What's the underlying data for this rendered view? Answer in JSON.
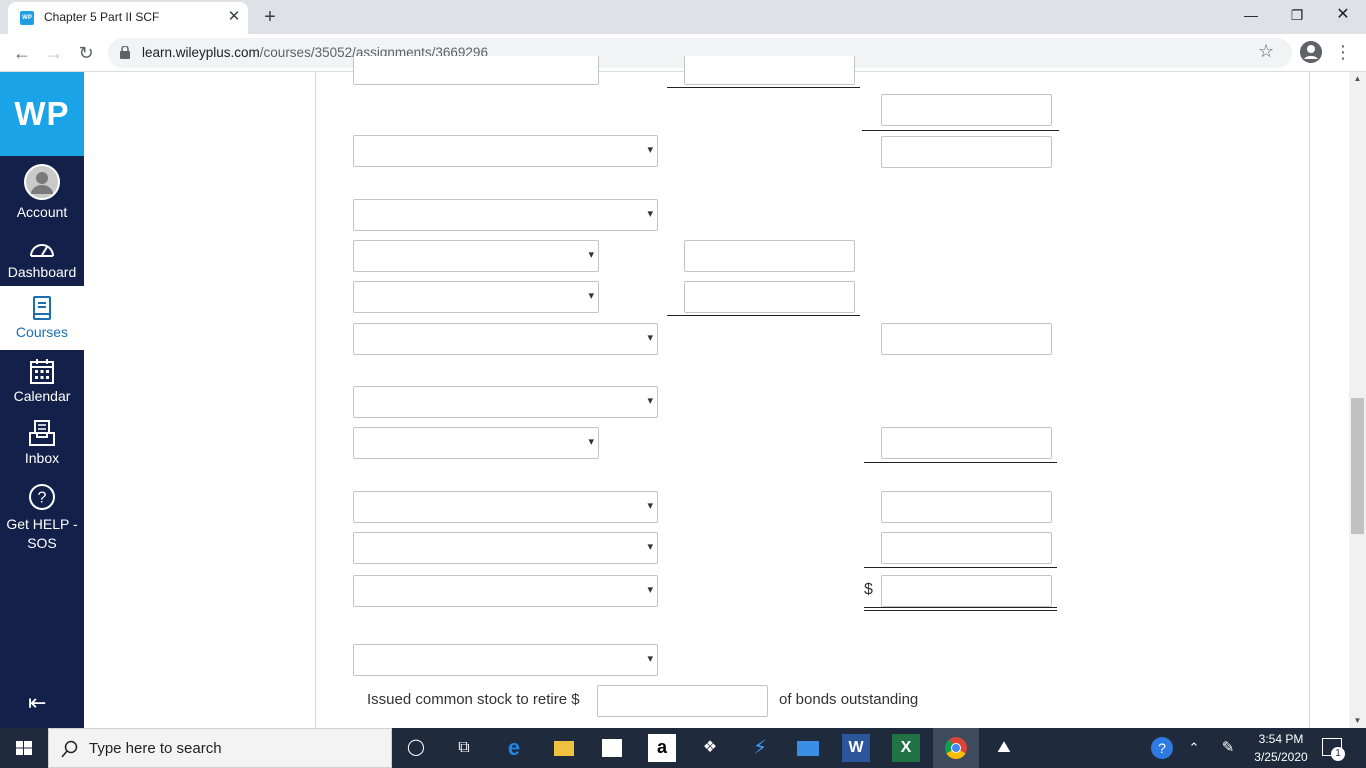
{
  "browser": {
    "tab_title": "Chapter 5 Part II SCF",
    "tab_favicon": "WP",
    "url_host": "learn.wileyplus.com",
    "url_path": "/courses/35052/assignments/3669296"
  },
  "sidebar": {
    "logo": "WP",
    "items": [
      {
        "label": "Account",
        "icon": "user-avatar-icon"
      },
      {
        "label": "Dashboard",
        "icon": "speedometer-icon"
      },
      {
        "label": "Courses",
        "icon": "book-icon"
      },
      {
        "label": "Calendar",
        "icon": "calendar-icon"
      },
      {
        "label": "Inbox",
        "icon": "inbox-icon"
      },
      {
        "label": "Get HELP - SOS",
        "icon": "help-icon"
      }
    ],
    "active_item": "Courses",
    "accent_color": "#1aa3e6",
    "bg_color": "#13204a"
  },
  "form": {
    "currency_symbol": "$",
    "noncash_text_before": "Issued common stock to retire $",
    "noncash_text_after": "of bonds outstanding"
  },
  "taskbar": {
    "search_placeholder": "Type here to search",
    "time": "3:54 PM",
    "date": "3/25/2020",
    "notification_count": "1"
  }
}
